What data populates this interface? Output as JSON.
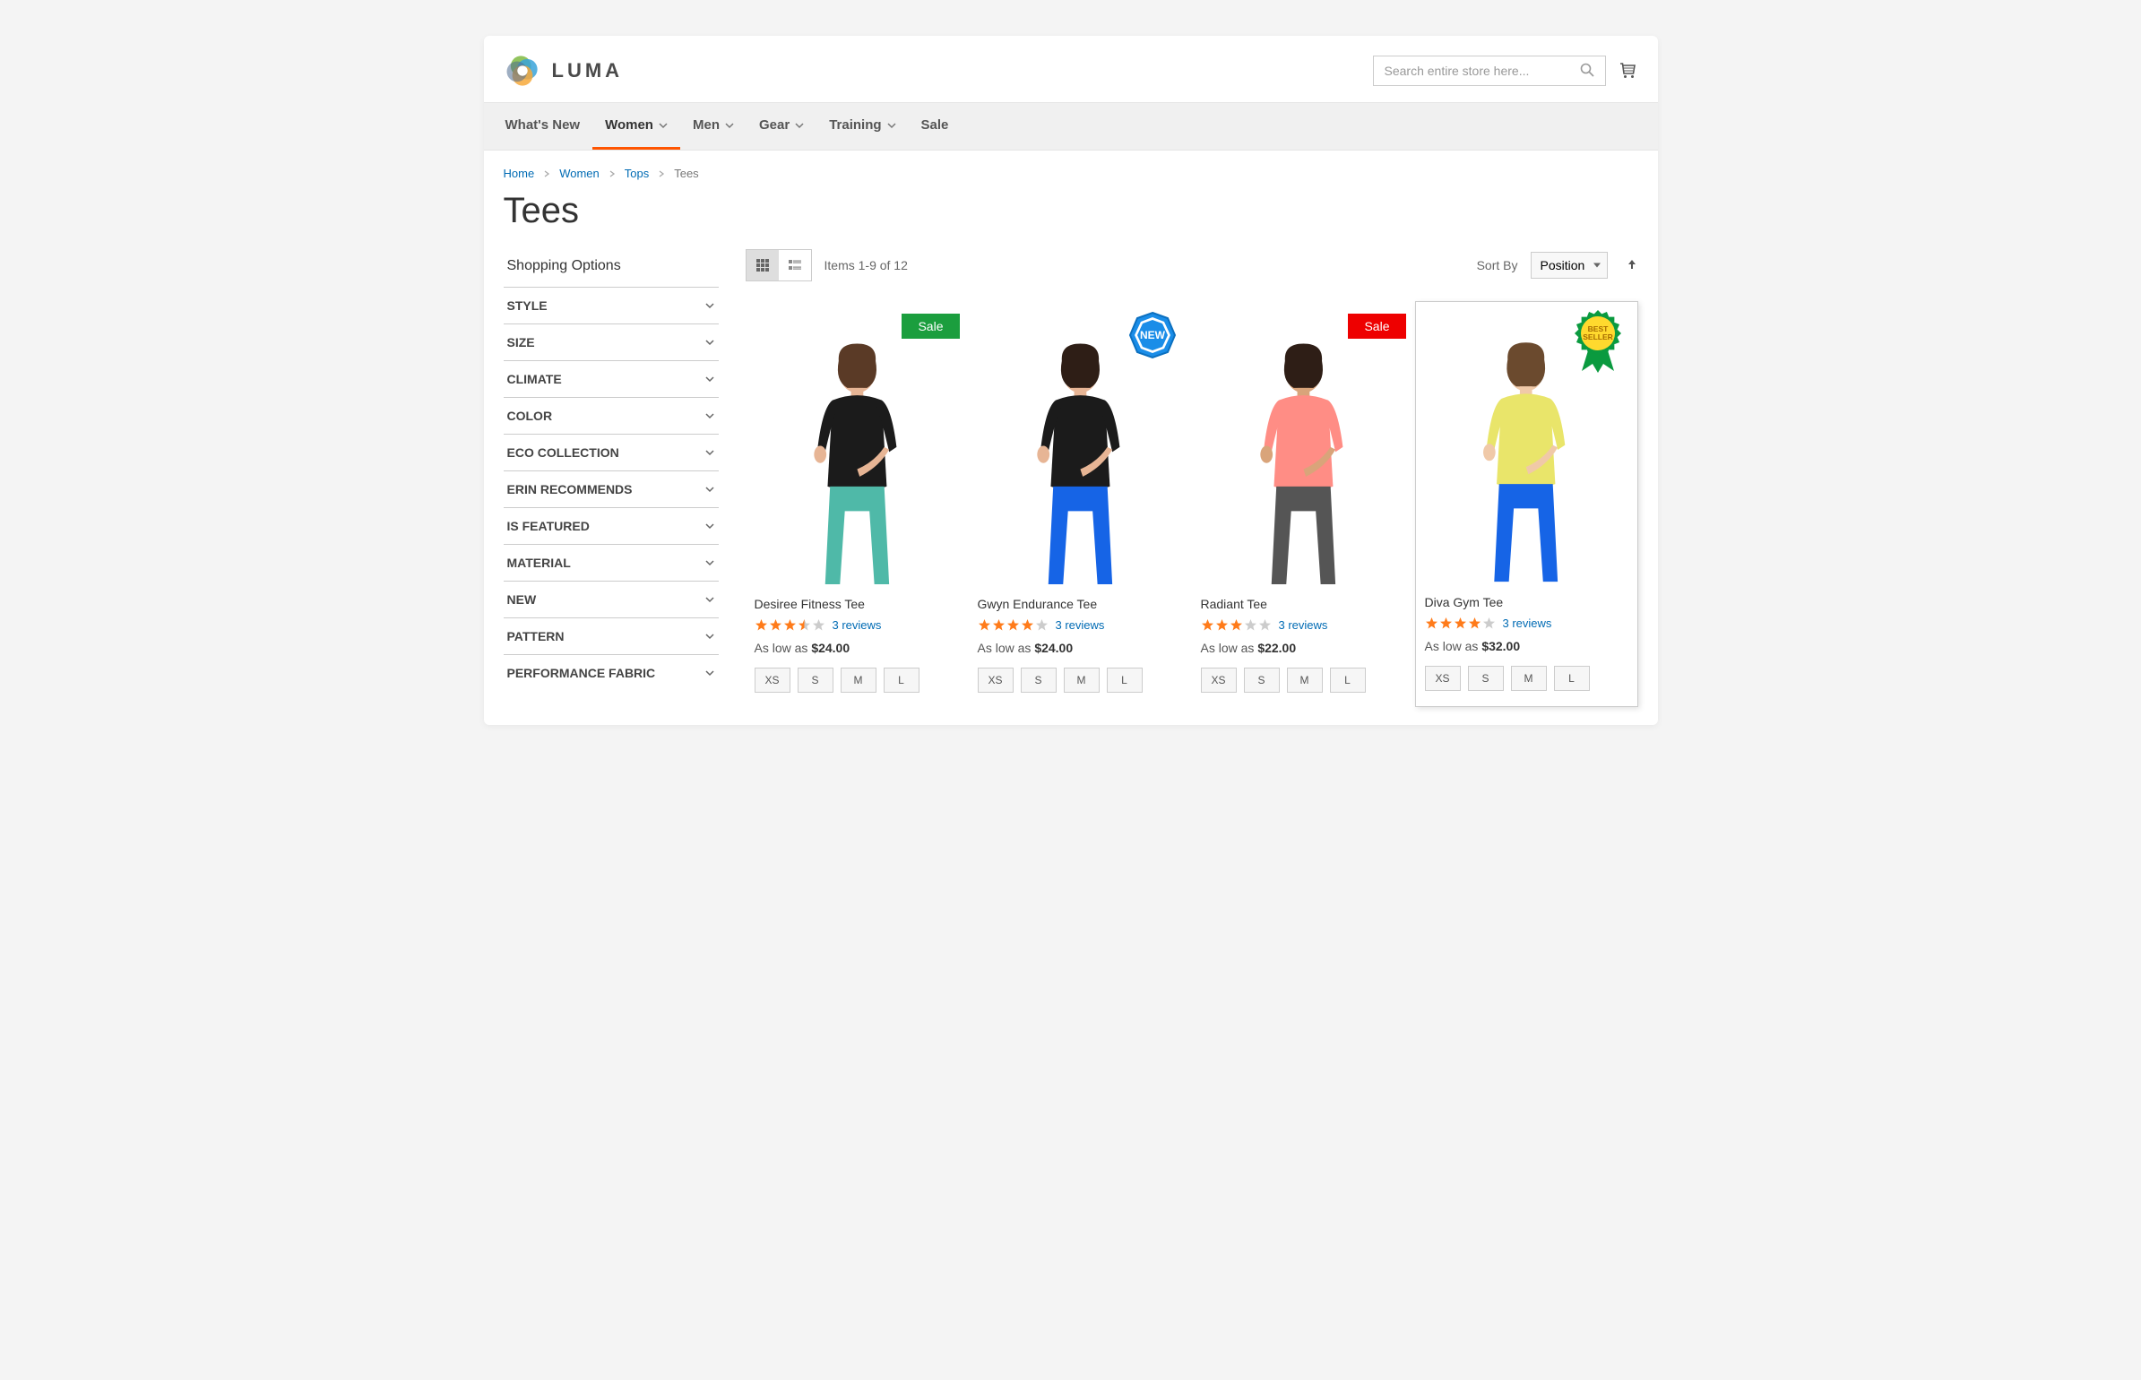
{
  "header": {
    "logo_text": "LUMA",
    "search_placeholder": "Search entire store here..."
  },
  "nav": {
    "items": [
      {
        "label": "What's New",
        "has_sub": false,
        "active": false
      },
      {
        "label": "Women",
        "has_sub": true,
        "active": true
      },
      {
        "label": "Men",
        "has_sub": true,
        "active": false
      },
      {
        "label": "Gear",
        "has_sub": true,
        "active": false
      },
      {
        "label": "Training",
        "has_sub": true,
        "active": false
      },
      {
        "label": "Sale",
        "has_sub": false,
        "active": false
      }
    ]
  },
  "breadcrumbs": {
    "items": [
      "Home",
      "Women",
      "Tops",
      "Tees"
    ]
  },
  "page": {
    "title": "Tees"
  },
  "sidebar": {
    "title": "Shopping Options",
    "filters": [
      "STYLE",
      "SIZE",
      "CLIMATE",
      "COLOR",
      "ECO COLLECTION",
      "ERIN RECOMMENDS",
      "IS FEATURED",
      "MATERIAL",
      "NEW",
      "PATTERN",
      "PERFORMANCE FABRIC"
    ]
  },
  "toolbar": {
    "amount_text": "Items 1-9 of 12",
    "sort_by_label": "Sort By",
    "sort_value": "Position"
  },
  "price_prefix": "As low as",
  "sizes": [
    "XS",
    "S",
    "M",
    "L"
  ],
  "products": [
    {
      "name": "Desiree Fitness Tee",
      "rating": 3.5,
      "reviews": "3 reviews",
      "price": "$24.00",
      "badge": {
        "type": "sale",
        "color": "green",
        "text": "Sale"
      },
      "colors": {
        "shirt": "#1b1b1b",
        "bottoms": "#4fb9a8",
        "skin": "#e7b595",
        "hair": "#5a3a26"
      }
    },
    {
      "name": "Gwyn Endurance Tee",
      "rating": 4.0,
      "reviews": "3 reviews",
      "price": "$24.00",
      "badge": {
        "type": "new",
        "text": "NEW"
      },
      "colors": {
        "shirt": "#1b1b1b",
        "bottoms": "#1664e6",
        "skin": "#e7b595",
        "hair": "#2e1e16"
      }
    },
    {
      "name": "Radiant Tee",
      "rating": 3.0,
      "reviews": "3 reviews",
      "price": "$22.00",
      "badge": {
        "type": "sale",
        "color": "red",
        "text": "Sale"
      },
      "colors": {
        "shirt": "#ff8d85",
        "bottoms": "#555",
        "skin": "#d9a47a",
        "hair": "#2e1e16"
      }
    },
    {
      "name": "Diva Gym Tee",
      "rating": 4.0,
      "reviews": "3 reviews",
      "price": "$32.00",
      "badge": {
        "type": "best",
        "text1": "BEST",
        "text2": "SELLER"
      },
      "highlight": true,
      "colors": {
        "shirt": "#e9e56a",
        "bottoms": "#1664e6",
        "skin": "#f0c9a8",
        "hair": "#6b4a2e"
      }
    }
  ]
}
